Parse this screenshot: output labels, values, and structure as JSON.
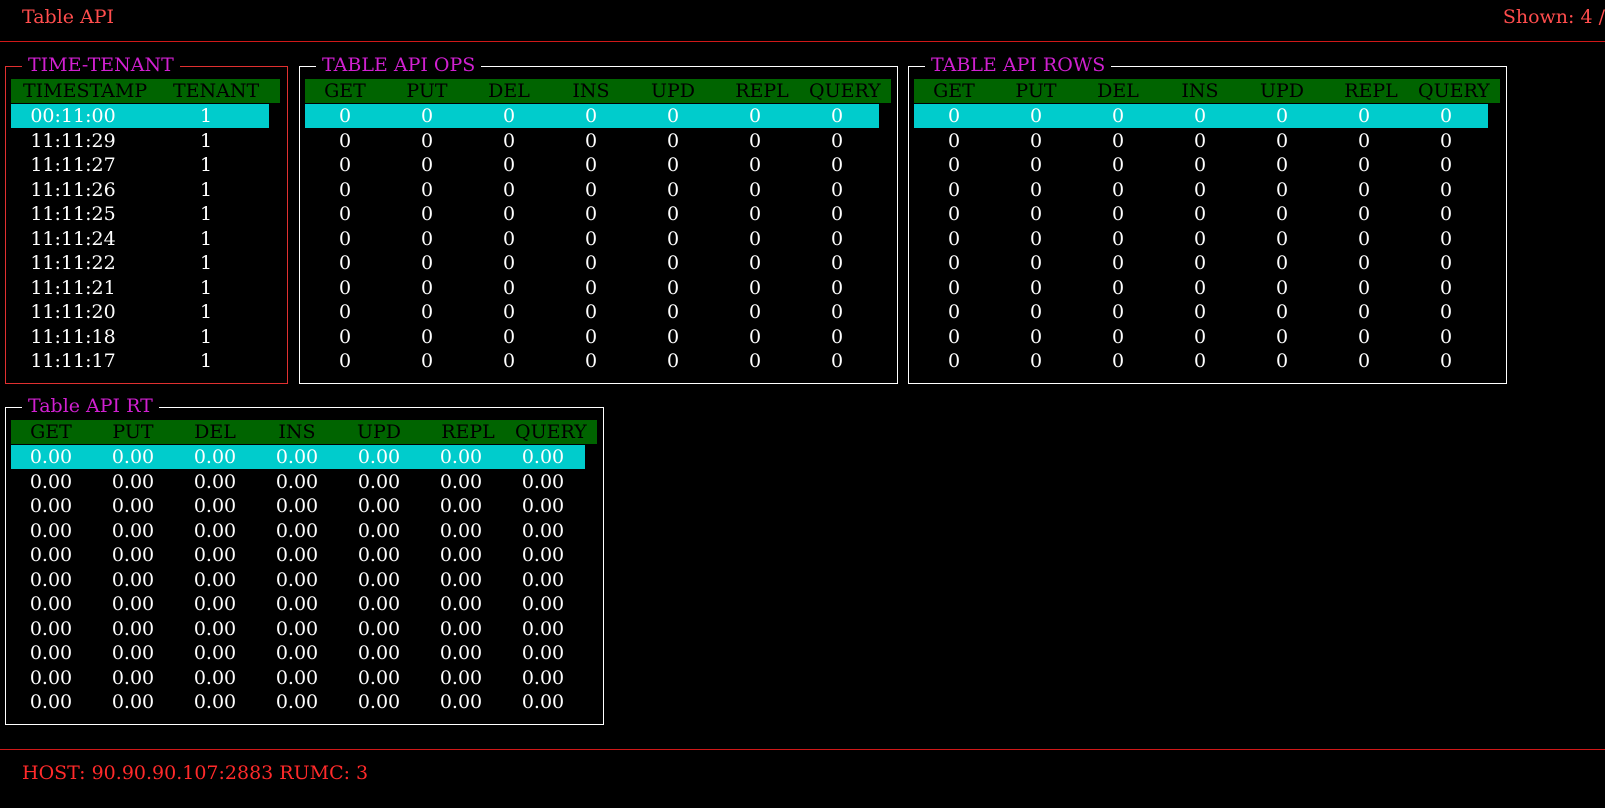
{
  "app": {
    "title": "Table API",
    "shown": "Shown: 4 /"
  },
  "panels": {
    "time_tenant": {
      "title": "TIME-TENANT",
      "columns": [
        "TIMESTAMP",
        "TENANT"
      ],
      "rows": [
        [
          "00:11:00",
          "1"
        ],
        [
          "11:11:29",
          "1"
        ],
        [
          "11:11:27",
          "1"
        ],
        [
          "11:11:26",
          "1"
        ],
        [
          "11:11:25",
          "1"
        ],
        [
          "11:11:24",
          "1"
        ],
        [
          "11:11:22",
          "1"
        ],
        [
          "11:11:21",
          "1"
        ],
        [
          "11:11:20",
          "1"
        ],
        [
          "11:11:18",
          "1"
        ],
        [
          "11:11:17",
          "1"
        ]
      ]
    },
    "ops": {
      "title": "TABLE API OPS",
      "columns": [
        "GET",
        "PUT",
        "DEL",
        "INS",
        "UPD",
        "REPL",
        "QUERY"
      ],
      "rows": [
        [
          "0",
          "0",
          "0",
          "0",
          "0",
          "0",
          "0"
        ],
        [
          "0",
          "0",
          "0",
          "0",
          "0",
          "0",
          "0"
        ],
        [
          "0",
          "0",
          "0",
          "0",
          "0",
          "0",
          "0"
        ],
        [
          "0",
          "0",
          "0",
          "0",
          "0",
          "0",
          "0"
        ],
        [
          "0",
          "0",
          "0",
          "0",
          "0",
          "0",
          "0"
        ],
        [
          "0",
          "0",
          "0",
          "0",
          "0",
          "0",
          "0"
        ],
        [
          "0",
          "0",
          "0",
          "0",
          "0",
          "0",
          "0"
        ],
        [
          "0",
          "0",
          "0",
          "0",
          "0",
          "0",
          "0"
        ],
        [
          "0",
          "0",
          "0",
          "0",
          "0",
          "0",
          "0"
        ],
        [
          "0",
          "0",
          "0",
          "0",
          "0",
          "0",
          "0"
        ],
        [
          "0",
          "0",
          "0",
          "0",
          "0",
          "0",
          "0"
        ]
      ]
    },
    "rows_panel": {
      "title": "TABLE API ROWS",
      "columns": [
        "GET",
        "PUT",
        "DEL",
        "INS",
        "UPD",
        "REPL",
        "QUERY"
      ],
      "rows": [
        [
          "0",
          "0",
          "0",
          "0",
          "0",
          "0",
          "0"
        ],
        [
          "0",
          "0",
          "0",
          "0",
          "0",
          "0",
          "0"
        ],
        [
          "0",
          "0",
          "0",
          "0",
          "0",
          "0",
          "0"
        ],
        [
          "0",
          "0",
          "0",
          "0",
          "0",
          "0",
          "0"
        ],
        [
          "0",
          "0",
          "0",
          "0",
          "0",
          "0",
          "0"
        ],
        [
          "0",
          "0",
          "0",
          "0",
          "0",
          "0",
          "0"
        ],
        [
          "0",
          "0",
          "0",
          "0",
          "0",
          "0",
          "0"
        ],
        [
          "0",
          "0",
          "0",
          "0",
          "0",
          "0",
          "0"
        ],
        [
          "0",
          "0",
          "0",
          "0",
          "0",
          "0",
          "0"
        ],
        [
          "0",
          "0",
          "0",
          "0",
          "0",
          "0",
          "0"
        ],
        [
          "0",
          "0",
          "0",
          "0",
          "0",
          "0",
          "0"
        ]
      ]
    },
    "rt": {
      "title": "Table API RT",
      "columns": [
        "GET",
        "PUT",
        "DEL",
        "INS",
        "UPD",
        "REPL",
        "QUERY"
      ],
      "rows": [
        [
          "0.00",
          "0.00",
          "0.00",
          "0.00",
          "0.00",
          "0.00",
          "0.00"
        ],
        [
          "0.00",
          "0.00",
          "0.00",
          "0.00",
          "0.00",
          "0.00",
          "0.00"
        ],
        [
          "0.00",
          "0.00",
          "0.00",
          "0.00",
          "0.00",
          "0.00",
          "0.00"
        ],
        [
          "0.00",
          "0.00",
          "0.00",
          "0.00",
          "0.00",
          "0.00",
          "0.00"
        ],
        [
          "0.00",
          "0.00",
          "0.00",
          "0.00",
          "0.00",
          "0.00",
          "0.00"
        ],
        [
          "0.00",
          "0.00",
          "0.00",
          "0.00",
          "0.00",
          "0.00",
          "0.00"
        ],
        [
          "0.00",
          "0.00",
          "0.00",
          "0.00",
          "0.00",
          "0.00",
          "0.00"
        ],
        [
          "0.00",
          "0.00",
          "0.00",
          "0.00",
          "0.00",
          "0.00",
          "0.00"
        ],
        [
          "0.00",
          "0.00",
          "0.00",
          "0.00",
          "0.00",
          "0.00",
          "0.00"
        ],
        [
          "0.00",
          "0.00",
          "0.00",
          "0.00",
          "0.00",
          "0.00",
          "0.00"
        ],
        [
          "0.00",
          "0.00",
          "0.00",
          "0.00",
          "0.00",
          "0.00",
          "0.00"
        ]
      ]
    }
  },
  "status": {
    "text": "HOST: 90.90.90.107:2883 RUMC: 3"
  },
  "colors": {
    "title": "#ff4d4d",
    "panel_title": "#d020d0",
    "header_bg": "#006400",
    "selected_row_bg": "#00cccc",
    "separator": "#d01818"
  }
}
